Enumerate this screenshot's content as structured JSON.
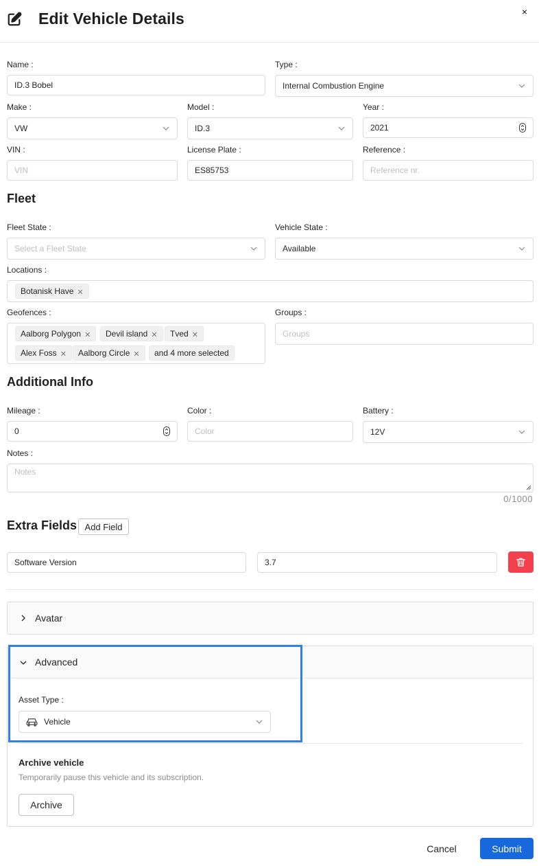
{
  "header": {
    "title": "Edit Vehicle Details",
    "close_label": "×"
  },
  "general": {
    "name_label": "Name :",
    "name_value": "ID.3 Bobel",
    "type_label": "Type :",
    "type_value": "Internal Combustion Engine",
    "make_label": "Make :",
    "make_value": "VW",
    "model_label": "Model :",
    "model_value": "ID.3",
    "year_label": "Year :",
    "year_value": "2021",
    "vin_label": "VIN :",
    "vin_placeholder": "VIN",
    "plate_label": "License Plate :",
    "plate_value": "ES85753",
    "reference_label": "Reference :",
    "reference_placeholder": "Reference nr."
  },
  "fleet": {
    "title": "Fleet",
    "fleet_state_label": "Fleet State :",
    "fleet_state_placeholder": "Select a Fleet State",
    "vehicle_state_label": "Vehicle State :",
    "vehicle_state_value": "Available",
    "locations_label": "Locations :",
    "locations": [
      "Botanisk Have"
    ],
    "geofences_label": "Geofences :",
    "geofences": [
      "Aalborg Polygon",
      "Devil island",
      "Tved",
      "Alex Foss",
      "Aalborg Circle"
    ],
    "geofences_more": "and 4 more selected",
    "groups_label": "Groups :",
    "groups_placeholder": "Groups"
  },
  "additional": {
    "title": "Additional Info",
    "mileage_label": "Mileage :",
    "mileage_value": "0",
    "color_label": "Color :",
    "color_placeholder": "Color",
    "battery_label": "Battery :",
    "battery_value": "12V",
    "notes_label": "Notes :",
    "notes_placeholder": "Notes",
    "notes_counter": "0/1000"
  },
  "extra": {
    "title": "Extra Fields",
    "add_label": "Add Field",
    "field_name": "Software Version",
    "field_value": "3.7"
  },
  "avatar": {
    "title": "Avatar"
  },
  "advanced": {
    "title": "Advanced",
    "asset_type_label": "Asset Type :",
    "asset_type_value": "Vehicle",
    "archive_title": "Archive vehicle",
    "archive_desc": "Temporarily pause this vehicle and its subscription.",
    "archive_button": "Archive"
  },
  "footer": {
    "cancel_label": "Cancel",
    "submit_label": "Submit"
  },
  "colors": {
    "primary": "#1668dc",
    "danger": "#f2414c",
    "highlight": "#2f80ed",
    "border": "#d9d9d9"
  }
}
